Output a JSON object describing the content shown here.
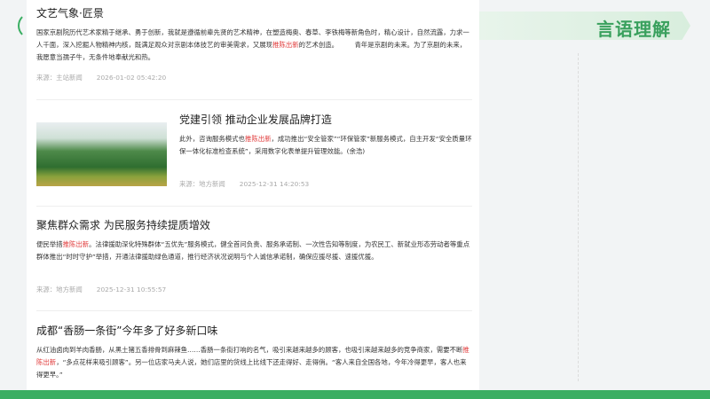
{
  "banner": {
    "title": "言语理解"
  },
  "articles": [
    {
      "title": "文艺气象·匠景",
      "body_pre": "国家京剧院历代艺术家精于继承、勇于创新，我就是遵循前辈先贤的艺术精神，在塑造梅奥、春草、李铁梅等新角色时，精心设计，自然流露，力求一人千面，深入挖掘人物精神内核，既满足观众对京剧本体技艺的审美需求，又展现",
      "highlight": "推陈出新",
      "body_post": "的艺术创造。　　　青年是京剧的未来。为了京剧的未来，我愿意当孺子牛，无条件地奉献光和热。",
      "source": "来源：主站新闻",
      "time": "2026-01-02 05:42:20"
    },
    {
      "title": "党建引领 推动企业发展品牌打造",
      "body_pre": "此外，咨询服务模式也",
      "highlight": "推陈出新",
      "body_post": "，成功推出“安全管家”“环保管家”新服务模式，自主开发“安全质量环保一体化标准检查系统”，采用数字化表单提升管理效能。(余浩)",
      "source": "来源：地方新闻",
      "time": "2025-12-31 14:20:53"
    },
    {
      "title": "聚焦群众需求 为民服务持续提质增效",
      "body_pre": "便民举措",
      "highlight": "推陈出新",
      "body_post": "。法律援助深化特殊群体“五优先”服务模式，健全首问负责、服务承诺制、一次性告知等制度，为农民工、新就业形态劳动者等重点群体推出“时时守护”举措，开通法律援助绿色通道，推行经济状况说明与个人诚信承诺制，确保应援尽援、速援优援。",
      "source": "来源：地方新闻",
      "time": "2025-12-31 10:55:57"
    },
    {
      "title": "成都“香肠一条街”今年多了好多新口味",
      "body_pre": "从红油卤肉到羊肉香肠，从黑土猪五香排骨到麻辣鱼……香肠一条街打响的名气，吸引来越来越多的顾客，也吸引来越来越多的竞争商家，需要不断",
      "highlight": "推陈出新",
      "body_post": "，“多点花样来吸引顾客”。另一位店家马夫人说，她们店里的货线上比线下还走得好、走得俏。“客人来自全国各地，今年冷得更早，客人也来得更早。”"
    }
  ]
}
